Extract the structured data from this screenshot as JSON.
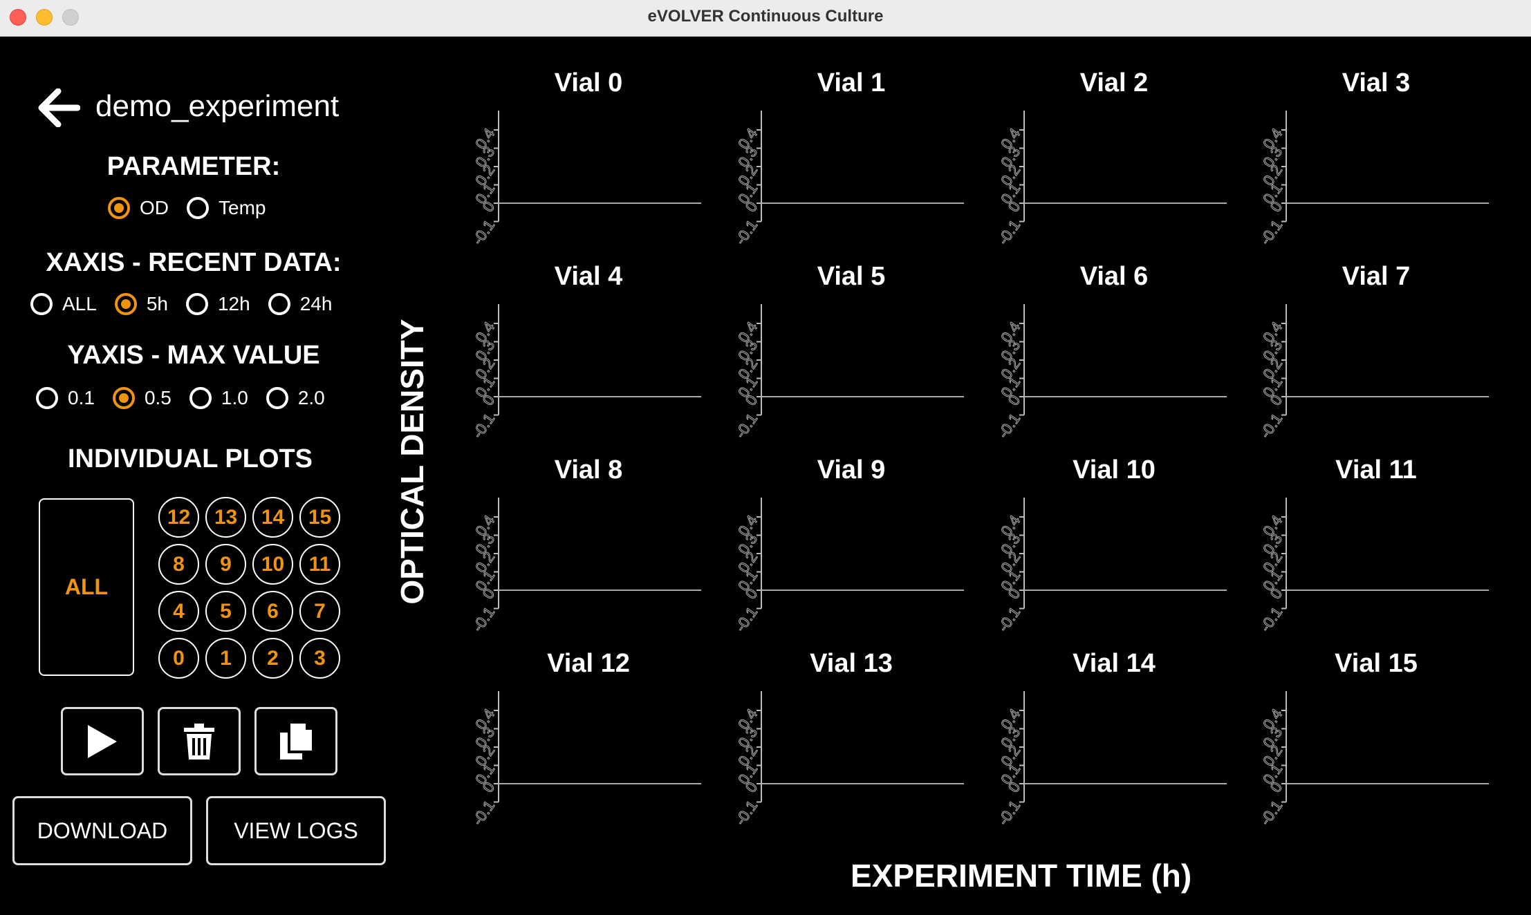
{
  "window": {
    "title": "eVOLVER Continuous Culture"
  },
  "experiment": {
    "name": "demo_experiment"
  },
  "parameter": {
    "heading": "PARAMETER:",
    "options": [
      {
        "label": "OD",
        "selected": true
      },
      {
        "label": "Temp",
        "selected": false
      }
    ]
  },
  "xaxis": {
    "heading": "XAXIS - RECENT DATA:",
    "options": [
      {
        "label": "ALL",
        "selected": false
      },
      {
        "label": "5h",
        "selected": true
      },
      {
        "label": "12h",
        "selected": false
      },
      {
        "label": "24h",
        "selected": false
      }
    ]
  },
  "yaxis": {
    "heading": "YAXIS - MAX VALUE",
    "options": [
      {
        "label": "0.1",
        "selected": false
      },
      {
        "label": "0.5",
        "selected": true
      },
      {
        "label": "1.0",
        "selected": false
      },
      {
        "label": "2.0",
        "selected": false
      }
    ]
  },
  "individual_plots": {
    "heading": "INDIVIDUAL PLOTS",
    "all_label": "ALL",
    "vials": [
      "12",
      "13",
      "14",
      "15",
      "8",
      "9",
      "10",
      "11",
      "4",
      "5",
      "6",
      "7",
      "0",
      "1",
      "2",
      "3"
    ]
  },
  "actions": {
    "icons": [
      "play-icon",
      "trash-icon",
      "copy-icon"
    ],
    "download_label": "DOWNLOAD",
    "view_logs_label": "VIEW LOGS"
  },
  "plots": {
    "ylabel": "OPTICAL DENSITY",
    "xlabel": "EXPERIMENT TIME (h)",
    "yticks": [
      "-0.1",
      "0",
      "0.1",
      "0.2",
      "0.3",
      "0.4"
    ],
    "titles": [
      "Vial 0",
      "Vial 1",
      "Vial 2",
      "Vial 3",
      "Vial 4",
      "Vial 5",
      "Vial 6",
      "Vial 7",
      "Vial 8",
      "Vial 9",
      "Vial 10",
      "Vial 11",
      "Vial 12",
      "Vial 13",
      "Vial 14",
      "Vial 15"
    ]
  },
  "colors": {
    "accent": "#f0940e",
    "background": "#000000",
    "text": "#ffffff",
    "axis": "#cccccc"
  }
}
